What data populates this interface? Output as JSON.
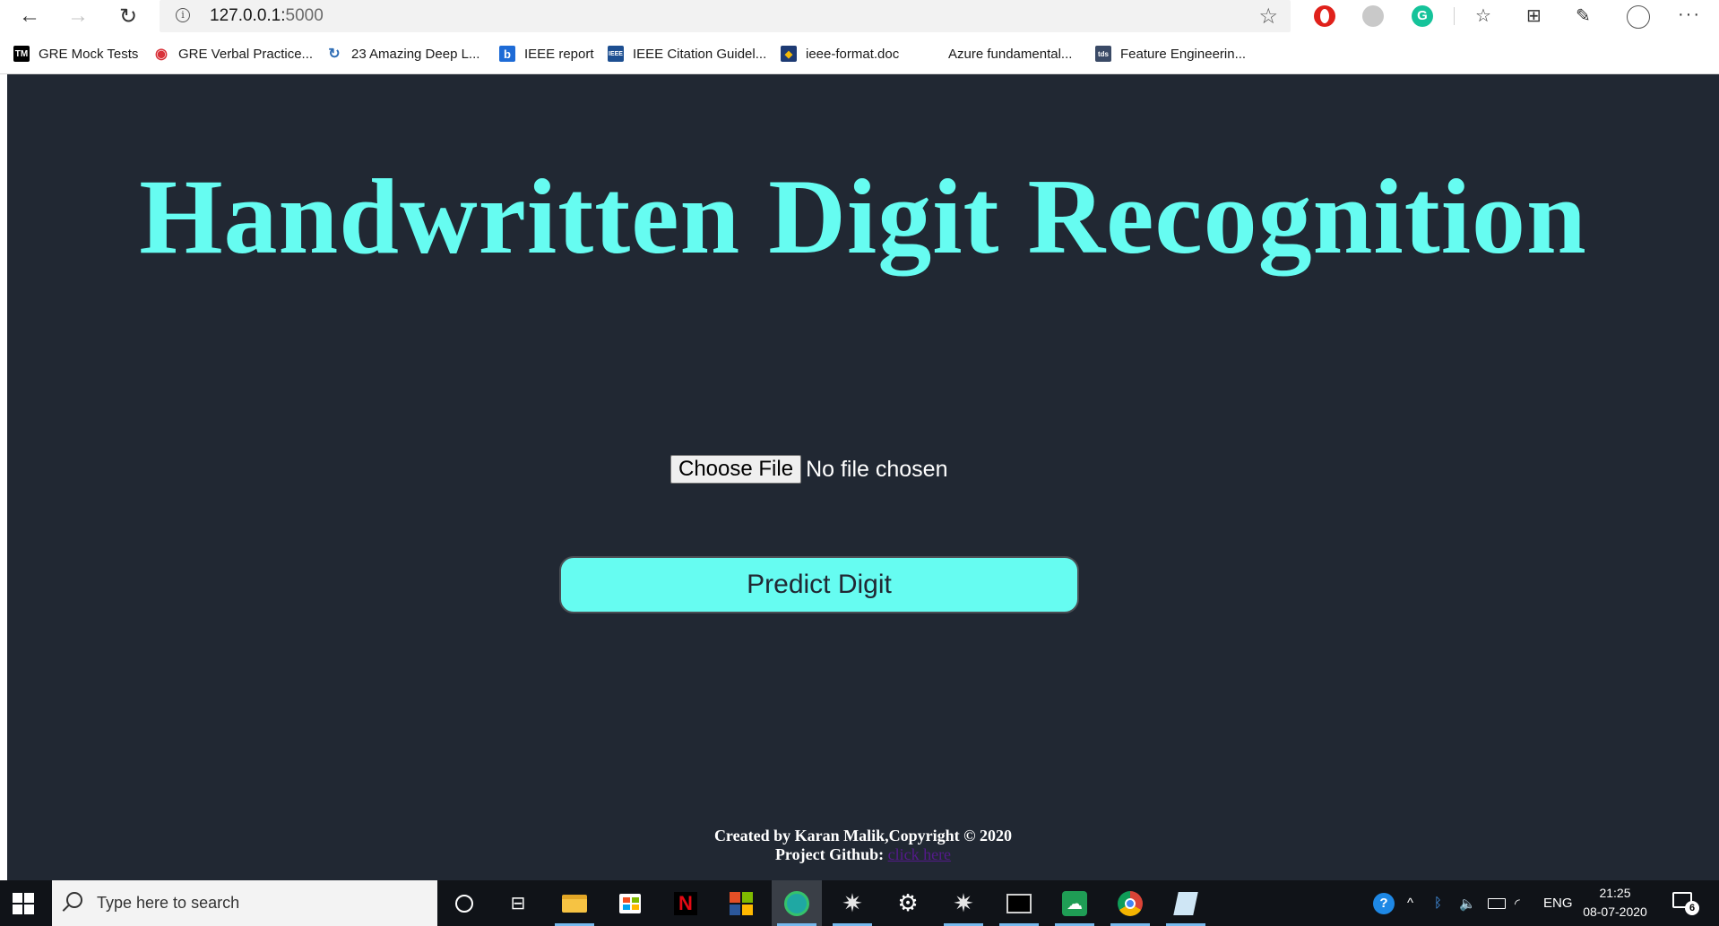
{
  "browser": {
    "url_host": "127.0.0.1:",
    "url_port": "5000"
  },
  "bookmarks": [
    {
      "label": "GRE Mock Tests",
      "icon": "tm-logo-icon",
      "color": "#000000",
      "glyph": "TM"
    },
    {
      "label": "GRE Verbal Practice...",
      "icon": "target-icon",
      "color": "#d9323a",
      "glyph": "◉"
    },
    {
      "label": "23 Amazing Deep L...",
      "icon": "swirl-icon",
      "color": "#2f6db5",
      "glyph": "↻"
    },
    {
      "label": "IEEE report",
      "icon": "b-logo-icon",
      "color": "#1e6bd6",
      "glyph": "b"
    },
    {
      "label": "IEEE Citation Guidel...",
      "icon": "ieee-logo-icon",
      "color": "#1d4f91",
      "glyph": "IEEE"
    },
    {
      "label": "ieee-format.doc",
      "icon": "shield-icon",
      "color": "#f2b807",
      "glyph": "◆"
    },
    {
      "label": "Azure fundamental...",
      "icon": "microsoft-logo-icon",
      "color": "#f25022",
      "glyph": ""
    },
    {
      "label": "Feature Engineerin...",
      "icon": "tds-logo-icon",
      "color": "#3a4a66",
      "glyph": "tds"
    }
  ],
  "page": {
    "title": "Handwritten Digit Recognition",
    "choose_file_label": "Choose File",
    "no_file_text": "No file chosen",
    "predict_label": "Predict Digit",
    "footer_line1": "Created by Karan Malik,Copyright © 2020",
    "footer_line2_prefix": "Project Github: ",
    "footer_link": "click here",
    "colors": {
      "background": "#212833",
      "accent": "#66fcf1"
    }
  },
  "taskbar": {
    "search_placeholder": "Type here to search",
    "language": "ENG",
    "time": "21:25",
    "date": "08-07-2020",
    "notification_count": "6"
  }
}
